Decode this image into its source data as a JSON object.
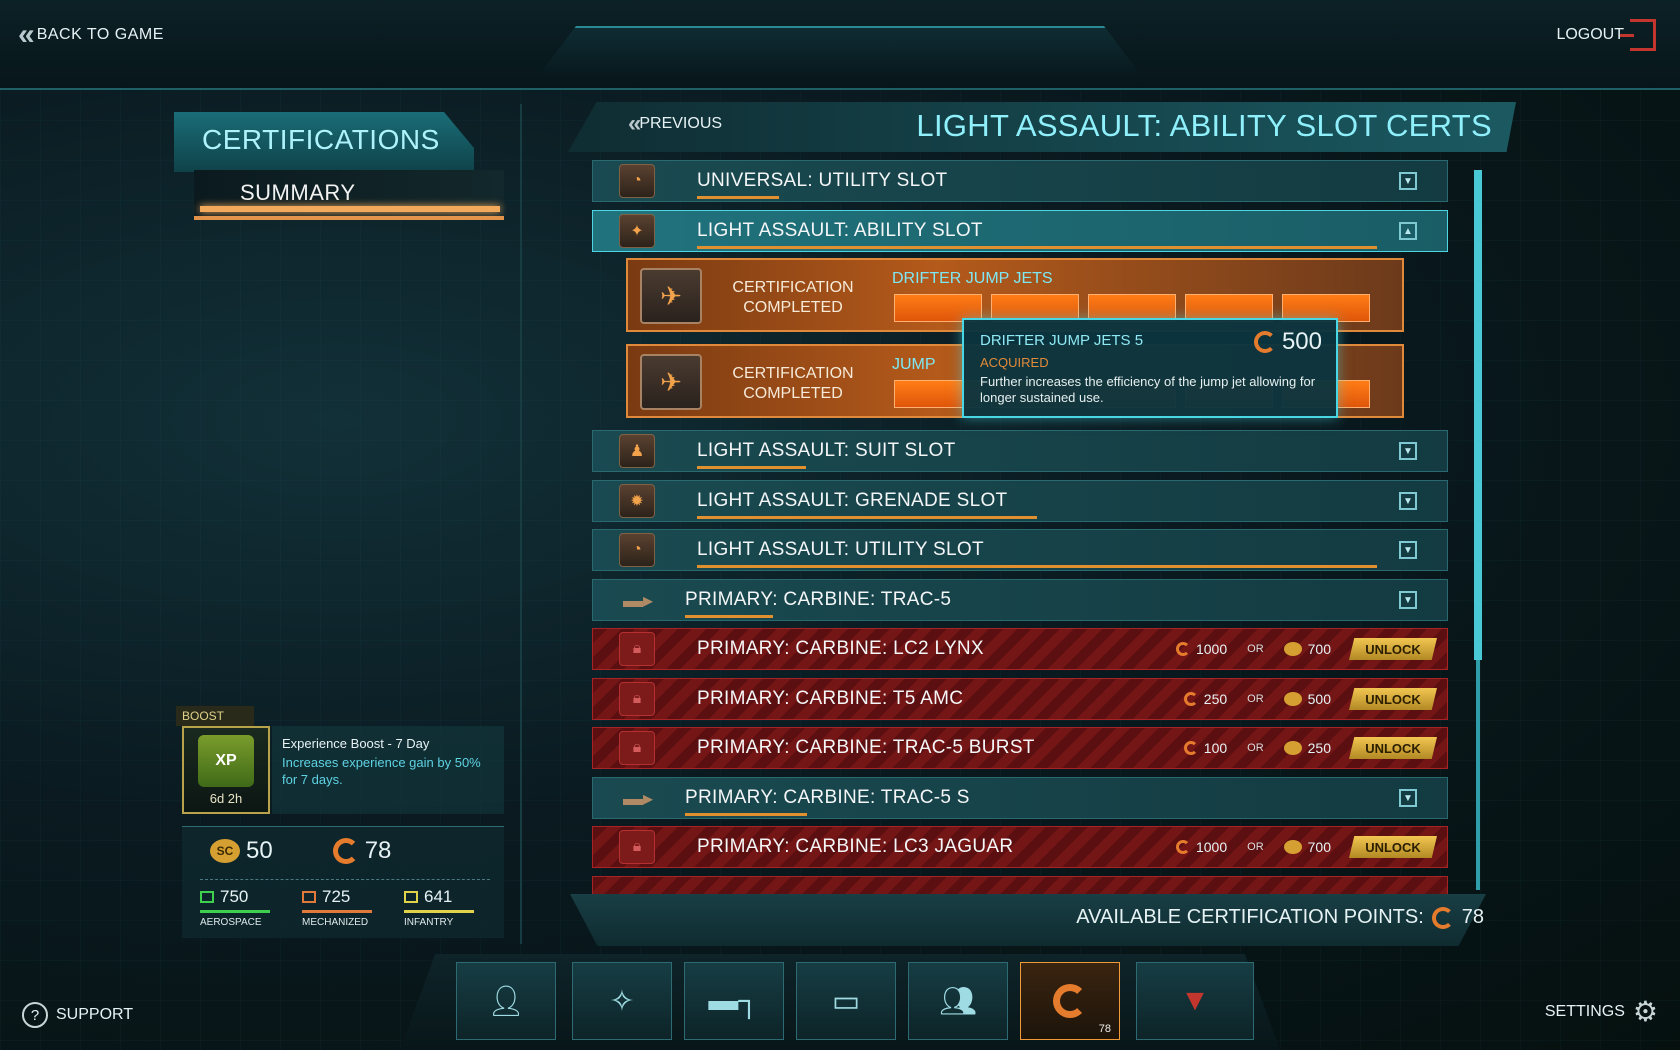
{
  "topbar": {
    "back_label": "BACK TO GAME",
    "logout_label": "LOGOUT"
  },
  "sidebar": {
    "certifications_tab": "CERTIFICATIONS",
    "summary_tab": "SUMMARY"
  },
  "boost": {
    "badge": "BOOST",
    "icon_text": "XP",
    "time_left": "6d 2h",
    "title": "Experience Boost - 7 Day",
    "description": "Increases experience gain by 50% for 7 days."
  },
  "resources": {
    "sc_label": "SC",
    "sc_value": "50",
    "cert_value": "78",
    "items": [
      {
        "value": "750",
        "label": "AEROSPACE",
        "color": "#3fcf4f"
      },
      {
        "value": "725",
        "label": "MECHANIZED",
        "color": "#e07a3a"
      },
      {
        "value": "641",
        "label": "INFANTRY",
        "color": "#e0d24a"
      }
    ]
  },
  "header": {
    "previous_label": "PREVIOUS",
    "title": "LIGHT ASSAULT: ABILITY SLOT CERTS"
  },
  "rows": [
    {
      "label": "UNIVERSAL: UTILITY SLOT",
      "progress": 0.12
    },
    {
      "label": "LIGHT ASSAULT: ABILITY SLOT",
      "progress": 1.0
    },
    {
      "label": "LIGHT ASSAULT: SUIT SLOT",
      "progress": 0.16
    },
    {
      "label": "LIGHT ASSAULT: GRENADE SLOT",
      "progress": 0.5
    },
    {
      "label": "LIGHT ASSAULT: UTILITY SLOT",
      "progress": 1.0
    },
    {
      "label": "PRIMARY: CARBINE: TRAC-5",
      "progress": 0.13
    },
    {
      "label": "PRIMARY: CARBINE: LC2 LYNX",
      "cert": "1000",
      "or": "OR",
      "sc": "700",
      "unlock": "UNLOCK"
    },
    {
      "label": "PRIMARY: CARBINE: T5 AMC",
      "cert": "250",
      "or": "OR",
      "sc": "500",
      "unlock": "UNLOCK"
    },
    {
      "label": "PRIMARY: CARBINE: TRAC-5 BURST",
      "cert": "100",
      "or": "OR",
      "sc": "250",
      "unlock": "UNLOCK"
    },
    {
      "label": "PRIMARY: CARBINE: TRAC-5 S",
      "progress": 0.18
    },
    {
      "label": "PRIMARY: CARBINE: LC3 JAGUAR",
      "cert": "1000",
      "or": "OR",
      "sc": "700",
      "unlock": "UNLOCK"
    }
  ],
  "sub_certs": [
    {
      "status": "CERTIFICATION COMPLETED",
      "name": "DRIFTER JUMP JETS",
      "pips_filled": 5,
      "pips_total": 5
    },
    {
      "status": "CERTIFICATION COMPLETED",
      "name": "JUMP",
      "pips_filled": 5,
      "pips_total": 5
    }
  ],
  "tooltip": {
    "title": "DRIFTER JUMP JETS 5",
    "cost": "500",
    "status": "ACQUIRED",
    "description": "Further increases the efficiency of the jump jet allowing for longer sustained use."
  },
  "available": {
    "label": "AVAILABLE CERTIFICATION POINTS:",
    "value": "78"
  },
  "nav": {
    "cert_badge": "78",
    "buttons": [
      "profile-icon",
      "compass-icon",
      "pistol-icon",
      "tank-icon",
      "squad-icon",
      "certification-icon",
      "faction-icon"
    ]
  },
  "footer": {
    "support_label": "SUPPORT",
    "settings_label": "SETTINGS"
  },
  "colors": {
    "accent_cyan": "#49d7e6",
    "accent_orange": "#e0902f",
    "locked_red": "#741516",
    "unlock_gold": "#f2c651"
  }
}
